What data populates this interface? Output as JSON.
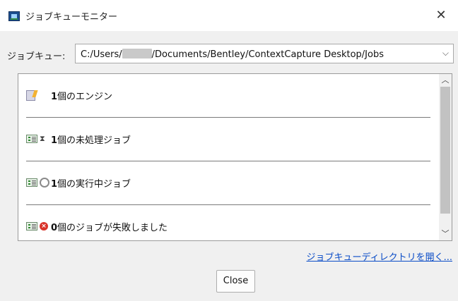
{
  "window": {
    "title": "ジョブキューモニター"
  },
  "queue": {
    "label": "ジョブキュー:",
    "path_prefix": "C:/Users/",
    "path_suffix": "/Documents/Bentley/ContextCapture Desktop/Jobs"
  },
  "status": {
    "items": [
      {
        "count": "1",
        "text": "個のエンジン",
        "icon": "engine-icon"
      },
      {
        "count": "1",
        "text": "個の未処理ジョブ",
        "icon": "pending-jobs-icon"
      },
      {
        "count": "1",
        "text": "個の実行中ジョブ",
        "icon": "running-jobs-icon"
      },
      {
        "count": "0",
        "text": "個のジョブが失敗しました",
        "icon": "failed-jobs-icon"
      }
    ]
  },
  "links": {
    "open_directory": "ジョブキューディレクトリを開く..."
  },
  "buttons": {
    "close": "Close"
  }
}
